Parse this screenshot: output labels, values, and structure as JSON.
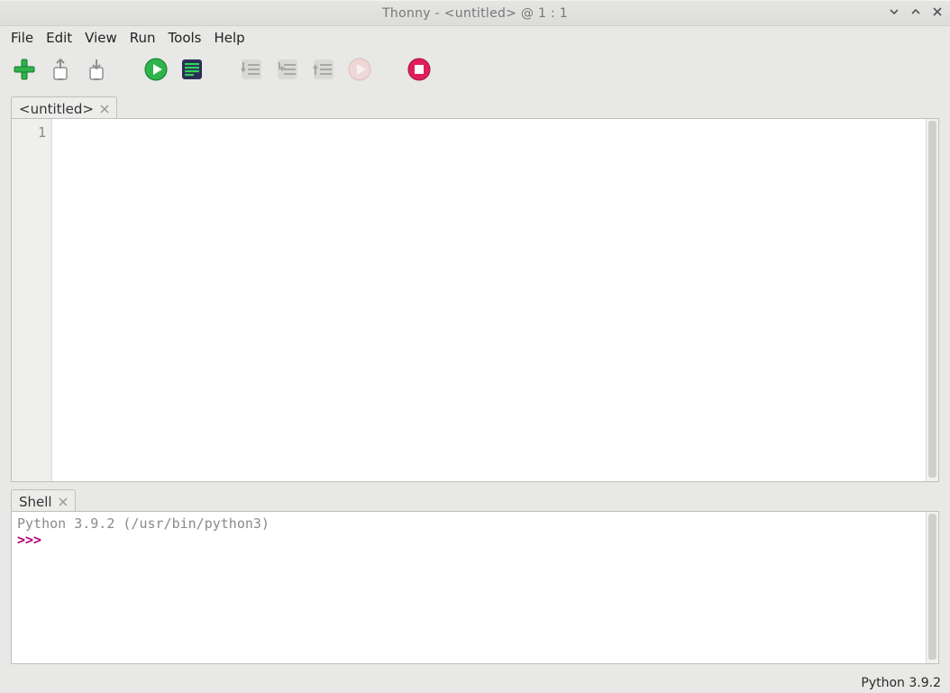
{
  "window": {
    "title": "Thonny  -  <untitled>  @  1 : 1"
  },
  "menu": {
    "items": [
      "File",
      "Edit",
      "View",
      "Run",
      "Tools",
      "Help"
    ]
  },
  "toolbar": {
    "new": {
      "icon": "plus-icon"
    },
    "open": {
      "icon": "open-icon"
    },
    "save": {
      "icon": "save-icon"
    },
    "run": {
      "icon": "play-icon"
    },
    "debug": {
      "icon": "debug-icon"
    },
    "step_over": {
      "icon": "step-over-icon"
    },
    "step_into": {
      "icon": "step-into-icon"
    },
    "step_out": {
      "icon": "step-out-icon"
    },
    "resume": {
      "icon": "resume-icon"
    },
    "stop": {
      "icon": "stop-icon"
    }
  },
  "editor": {
    "tab_label": "<untitled>",
    "line_numbers": [
      "1"
    ],
    "content": ""
  },
  "shell": {
    "tab_label": "Shell",
    "banner": "Python 3.9.2 (/usr/bin/python3)",
    "prompt": ">>> "
  },
  "status": {
    "interpreter": "Python 3.9.2"
  },
  "colors": {
    "bg": "#e8e8e6",
    "border": "#bfbfbd",
    "gutter_bg": "#efefed",
    "gutter_fg": "#8a8a88",
    "green": "#2fb34b",
    "debug_bg": "#2b2e55",
    "debug_fg": "#2fd25a",
    "disabled": "#bdbdbb",
    "stop": "#e01f5a",
    "prompt": "#b00078"
  }
}
